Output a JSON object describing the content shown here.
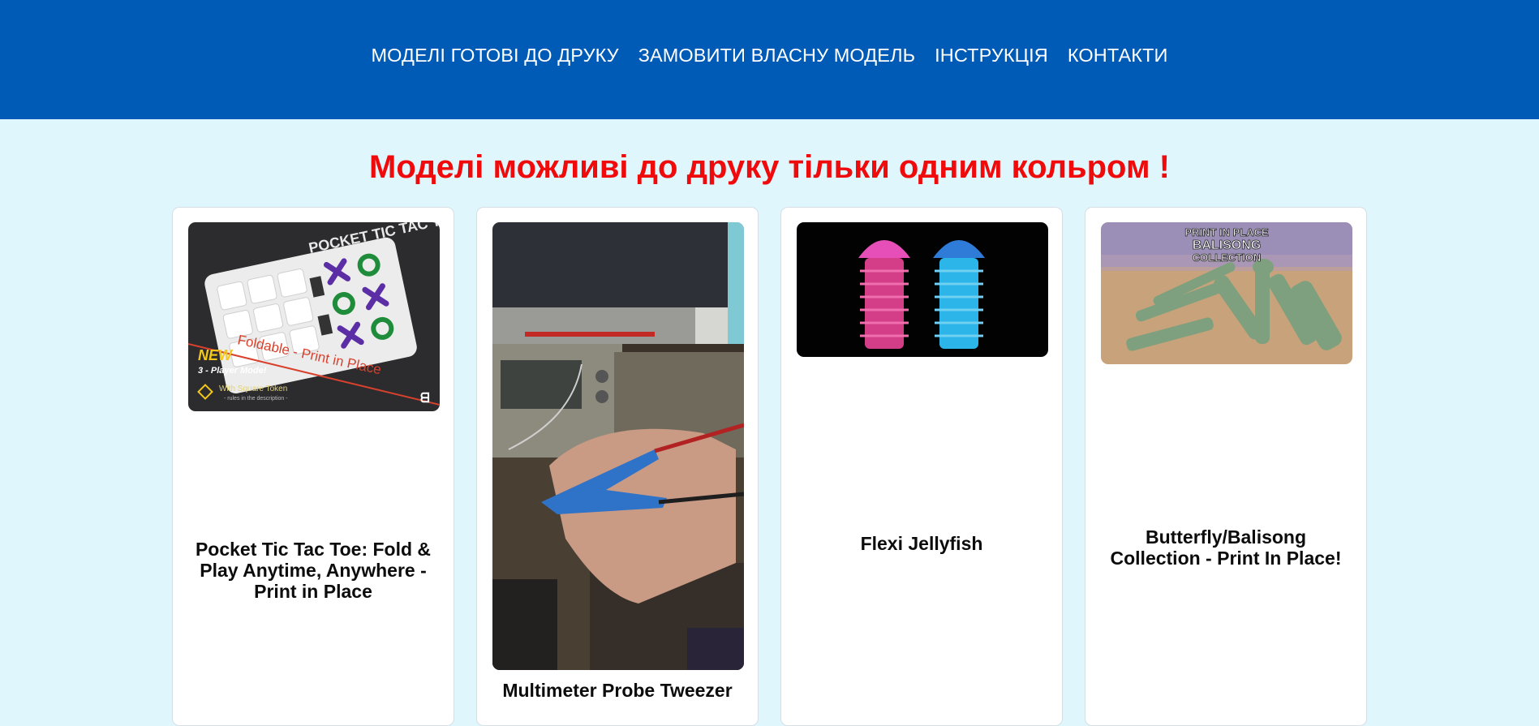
{
  "nav": {
    "items": [
      "МОДЕЛІ ГОТОВІ ДО ДРУКУ",
      "ЗАМОВИТИ ВЛАСНУ МОДЕЛЬ",
      "ІНСТРУКЦІЯ",
      "КОНТАКТИ"
    ]
  },
  "notice": "Моделі можливі до друку тільки одним кольром !",
  "products": [
    {
      "title": "Pocket Tic Tac Toe: Fold & Play Anytime, Anywhere - Print in Place",
      "image_text": {
        "headline": "POCKET TIC TAC TOE",
        "subline": "Foldable - Print in Place",
        "badge": "NEW",
        "mode": "3 - Player Mode!",
        "token": "With Square Token",
        "rules": "- rules in the description -"
      }
    },
    {
      "title": "Multimeter Probe Tweezer"
    },
    {
      "title": "Flexi Jellyfish"
    },
    {
      "title": "Butterfly/Balisong Collection - Print In Place!",
      "image_text": {
        "line1": "PRINT IN PLACE",
        "line2": "BALISONG",
        "line3": "COLLECTION"
      }
    }
  ],
  "colors": {
    "topbar": "#005bb7",
    "page_background": "#dff6fd",
    "notice": "#ef0b0b"
  }
}
